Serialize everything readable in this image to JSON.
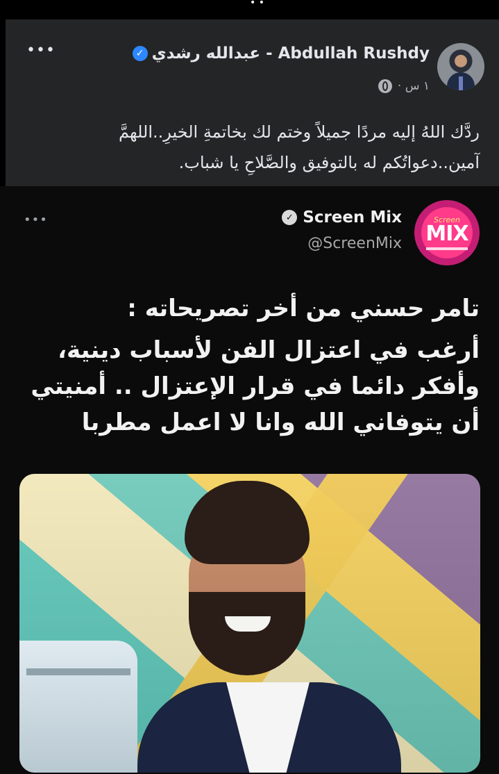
{
  "top_sliver": {
    "glyph": "• •"
  },
  "fb_post": {
    "author_name": "عبدالله رشدي - Abdullah Rushdy",
    "time": "١ س ·",
    "privacy_icon": "globe-icon",
    "more_icon": "more-horizontal-icon",
    "more_label": "•••",
    "text_line1": "ردَّك اللهُ إليه مردًا جميلاً وختم لك بخاتمةِ الخيرِ..اللهمَّ",
    "text_line2": "آمين..دعواتُكم له بالتوفيق والصَّلاحِ يا شباب."
  },
  "tweet": {
    "account_name": "Screen Mix",
    "handle": "@ScreenMix",
    "logo": {
      "small": "Screen",
      "big": "MIX"
    },
    "more_label": "•••",
    "headline": "تامر حسني من أخر تصريحاته :",
    "body": "أرغب في اعتزال الفن لأسباب دينية، وأفكر دائما في قرار الإعتزال .. أمنيتي أن يتوفاني الله وانا لا اعمل مطربا"
  },
  "colors": {
    "fb_bg": "#242526",
    "verified_blue": "#2d88ff",
    "tweet_bg": "#0b0b0b",
    "logo_pink": "#ff3b8a"
  }
}
